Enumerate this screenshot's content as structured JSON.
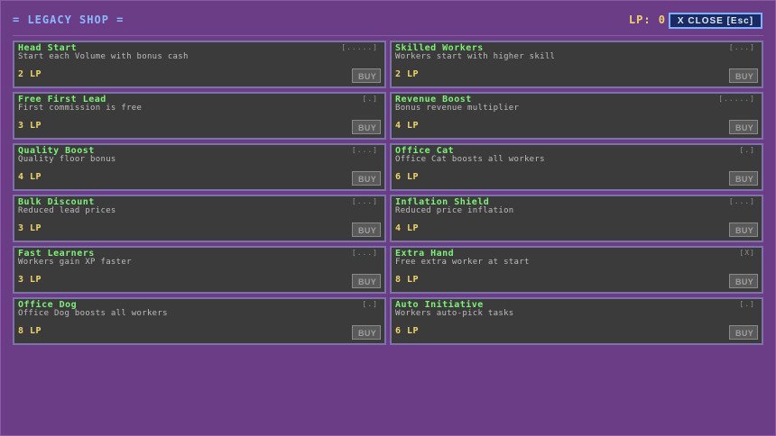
{
  "header": {
    "title": "= LEGACY SHOP =",
    "lp_label": "LP: 0",
    "close_label": "X CLOSE [Esc]"
  },
  "shop": {
    "items": [
      {
        "title": "Head Start",
        "desc": "Start each Volume with bonus cash",
        "level": "[.....]",
        "cost": "2 LP",
        "buy": "BUY"
      },
      {
        "title": "Skilled Workers",
        "desc": "Workers start with higher skill",
        "level": "[...]",
        "cost": "2 LP",
        "buy": "BUY"
      },
      {
        "title": "Free First Lead",
        "desc": "First commission is free",
        "level": "[.]",
        "cost": "3 LP",
        "buy": "BUY"
      },
      {
        "title": "Revenue Boost",
        "desc": "Bonus revenue multiplier",
        "level": "[.....]",
        "cost": "4 LP",
        "buy": "BUY"
      },
      {
        "title": "Quality Boost",
        "desc": "Quality floor bonus",
        "level": "[...]",
        "cost": "4 LP",
        "buy": "BUY"
      },
      {
        "title": "Office Cat",
        "desc": "Office Cat boosts all workers",
        "level": "[.]",
        "cost": "6 LP",
        "buy": "BUY"
      },
      {
        "title": "Bulk Discount",
        "desc": "Reduced lead prices",
        "level": "[...]",
        "cost": "3 LP",
        "buy": "BUY"
      },
      {
        "title": "Inflation Shield",
        "desc": "Reduced price inflation",
        "level": "[...]",
        "cost": "4 LP",
        "buy": "BUY"
      },
      {
        "title": "Fast Learners",
        "desc": "Workers gain XP faster",
        "level": "[...]",
        "cost": "3 LP",
        "buy": "BUY"
      },
      {
        "title": "Extra Hand",
        "desc": "Free extra worker at start",
        "level": "[X]",
        "cost": "8 LP",
        "buy": "BUY"
      },
      {
        "title": "Office Dog",
        "desc": "Office Dog boosts all workers",
        "level": "[.]",
        "cost": "8 LP",
        "buy": "BUY"
      },
      {
        "title": "Auto Initiative",
        "desc": "Workers auto-pick tasks",
        "level": "[.]",
        "cost": "6 LP",
        "buy": "BUY"
      }
    ]
  },
  "colors": {
    "background": "#6a3d86",
    "card": "#3b3b3b",
    "card_border": "#7d73a9",
    "title_green": "#7ff07a",
    "cost_yellow": "#f1d36b",
    "accent_blue": "#8bb8ff"
  }
}
